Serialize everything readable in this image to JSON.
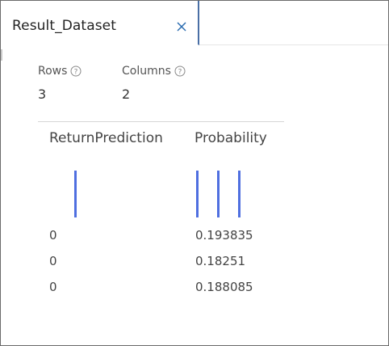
{
  "tab": {
    "title": "Result_Dataset",
    "close_icon": "close-icon"
  },
  "summary": {
    "rows_label": "Rows",
    "rows_value": "3",
    "columns_label": "Columns",
    "columns_value": "2",
    "help_icon": "question-circle-icon"
  },
  "table": {
    "columns": [
      "ReturnPrediction",
      "Probability"
    ],
    "rows": [
      [
        "0",
        "0.193835"
      ],
      [
        "0",
        "0.18251"
      ],
      [
        "0",
        "0.188085"
      ]
    ]
  },
  "histograms": {
    "bar_color": "#4f6fe0",
    "ReturnPrediction": {
      "bars": [
        1
      ]
    },
    "Probability": {
      "bars": [
        1,
        1,
        1
      ]
    }
  },
  "colors": {
    "tab_border": "#4a6fa5",
    "close_icon": "#2b6cb0",
    "divider": "#d6d6d6"
  }
}
